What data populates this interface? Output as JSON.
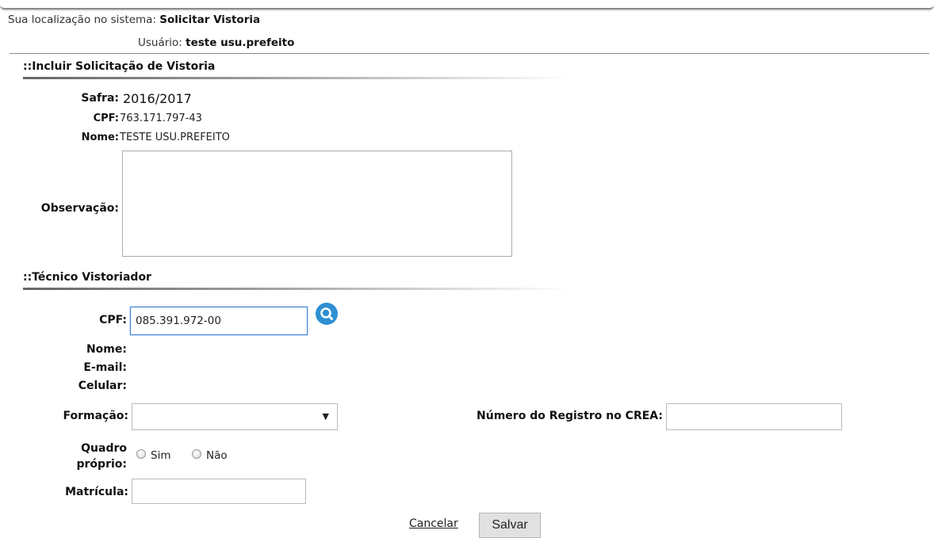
{
  "location": {
    "label": "Sua localização no sistema:",
    "value": "Solicitar Vistoria"
  },
  "user": {
    "label": "Usuário:",
    "value": "teste usu.prefeito"
  },
  "section_request": {
    "title": "::Incluir Solicitação de Vistoria",
    "safra_label": "Safra:",
    "safra_value": "2016/2017",
    "cpf_label": "CPF:",
    "cpf_value": "763.171.797-43",
    "nome_label": "Nome:",
    "nome_value": "TESTE USU.PREFEITO",
    "observacao_label": "Observação:",
    "observacao_value": ""
  },
  "section_tecnico": {
    "title": "::Técnico Vistoriador",
    "cpf_label": "CPF:",
    "cpf_value": "085.391.972-00",
    "search_icon": "search-icon",
    "nome_label": "Nome:",
    "email_label": "E-mail:",
    "celular_label": "Celular:",
    "formacao_label": "Formação:",
    "formacao_selected": "",
    "crea_label": "Número do Registro no CREA:",
    "crea_value": "",
    "quadro_label_1": "Quadro",
    "quadro_label_2": "próprio:",
    "quadro_options": [
      "Sim",
      "Não"
    ],
    "matricula_label": "Matrícula:",
    "matricula_value": ""
  },
  "actions": {
    "cancel_label": "Cancelar",
    "save_label": "Salvar"
  },
  "colors": {
    "accent": "#2e90d3",
    "focus_border": "#3d7fd6",
    "button_bg": "#e1e1e1"
  }
}
